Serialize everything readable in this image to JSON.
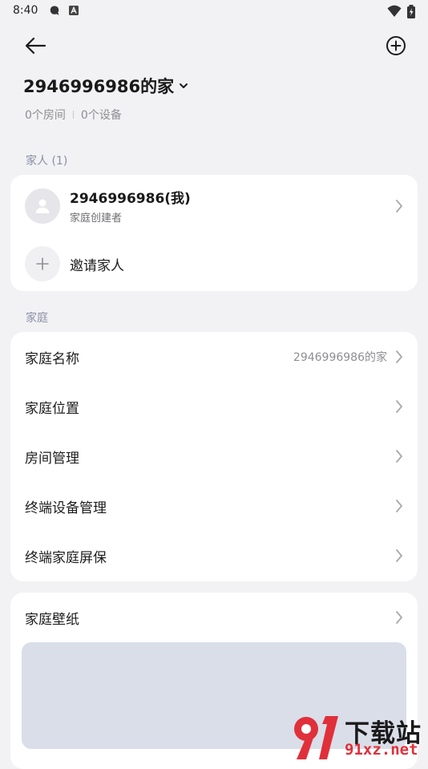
{
  "status_bar": {
    "time": "8:40",
    "left_icons": [
      "chat-icon",
      "a-box-icon"
    ],
    "right_icons": [
      "wifi-icon",
      "battery-icon"
    ]
  },
  "top_bar": {
    "back_icon": "arrow-left-icon",
    "add_icon": "plus-circle-icon"
  },
  "family": {
    "title": "2946996986的家",
    "rooms": "0个房间",
    "devices": "0个设备"
  },
  "members_section": {
    "label": "家人 (1)",
    "member": {
      "name": "2946996986(我)",
      "role": "家庭创建者"
    },
    "invite_label": "邀请家人"
  },
  "family_section": {
    "label": "家庭",
    "items": [
      {
        "label": "家庭名称",
        "value": "2946996986的家"
      },
      {
        "label": "家庭位置",
        "value": ""
      },
      {
        "label": "房间管理",
        "value": ""
      },
      {
        "label": "终端设备管理",
        "value": ""
      },
      {
        "label": "终端家庭屏保",
        "value": ""
      }
    ]
  },
  "wallpaper": {
    "label": "家庭壁纸"
  },
  "watermark": {
    "cn": "下载站",
    "en": "91xz.net"
  },
  "colors": {
    "background": "#f2f2f4",
    "card": "#ffffff",
    "section_label": "#8a8fa8",
    "wallpaper_preview": "#d9dee9",
    "watermark_red": "#e0303a"
  }
}
